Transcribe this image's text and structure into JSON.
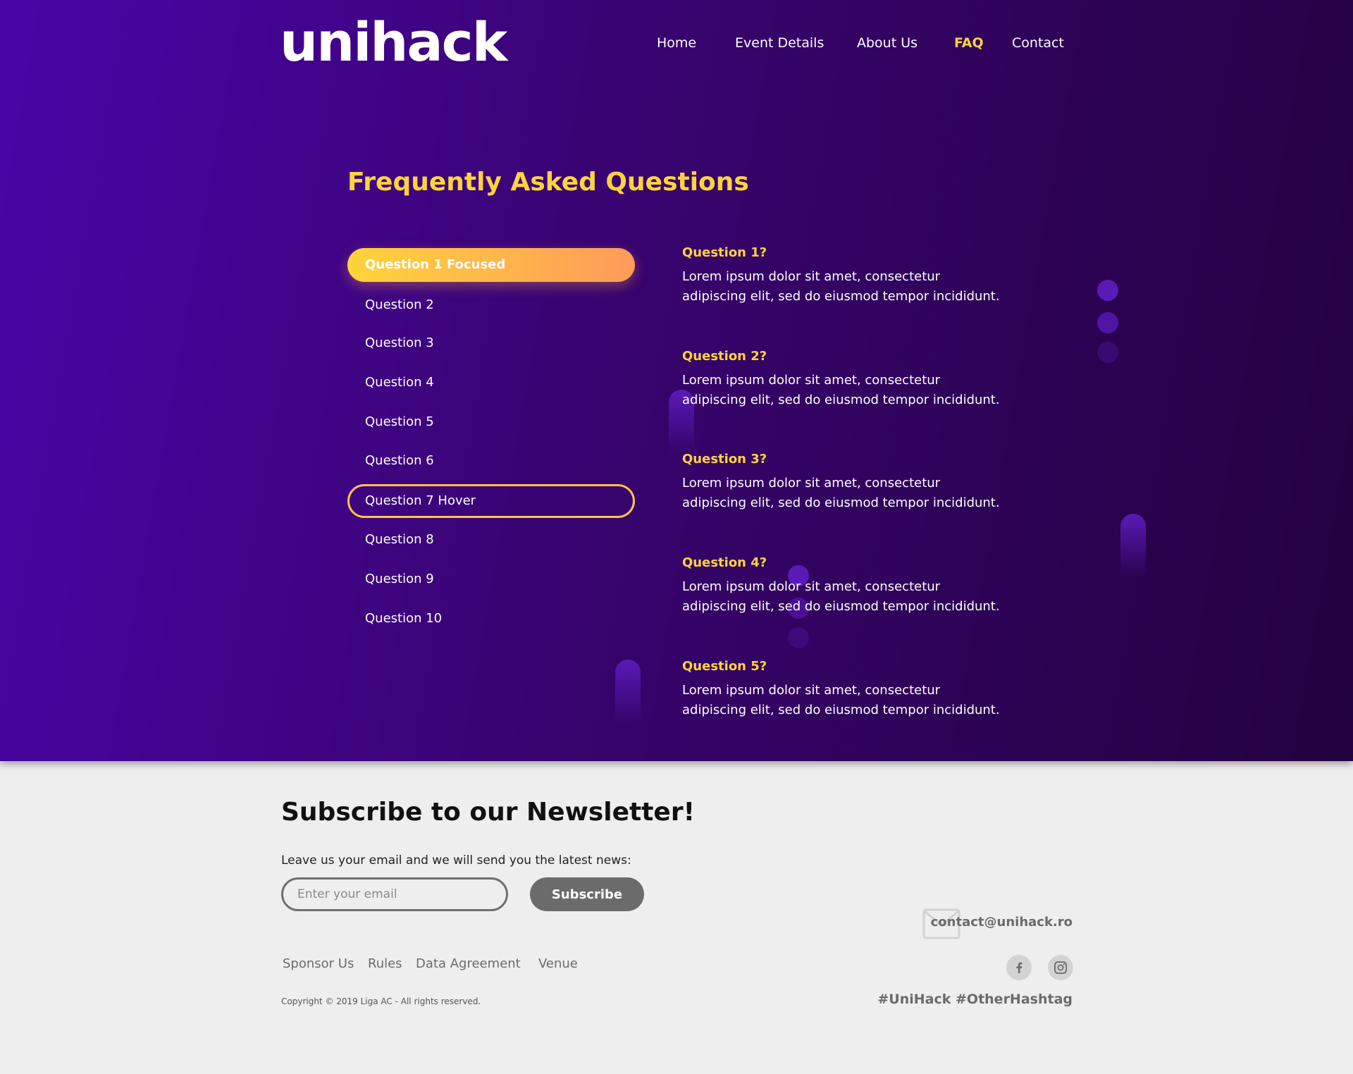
{
  "header": {
    "logo": "unihack",
    "nav": [
      {
        "label": "Home",
        "active": false
      },
      {
        "label": "Event Details",
        "active": false
      },
      {
        "label": "About Us",
        "active": false
      },
      {
        "label": "FAQ",
        "active": true
      },
      {
        "label": "Contact",
        "active": false
      }
    ]
  },
  "faq": {
    "title": "Frequently Asked Questions",
    "questions": [
      {
        "label": "Question 1 Focused",
        "state": "focused"
      },
      {
        "label": "Question 2",
        "state": "default"
      },
      {
        "label": "Question 3",
        "state": "default"
      },
      {
        "label": "Question 4",
        "state": "default"
      },
      {
        "label": "Question 5",
        "state": "default"
      },
      {
        "label": "Question 6",
        "state": "default"
      },
      {
        "label": "Question 7 Hover",
        "state": "hover"
      },
      {
        "label": "Question 8",
        "state": "default"
      },
      {
        "label": "Question 9",
        "state": "default"
      },
      {
        "label": "Question 10",
        "state": "default"
      }
    ],
    "answers": [
      {
        "question": "Question 1?",
        "text": "Lorem ipsum dolor sit amet, consectetur adipiscing elit, sed do eiusmod tempor incididunt."
      },
      {
        "question": "Question 2?",
        "text": "Lorem ipsum dolor sit amet, consectetur adipiscing elit, sed do eiusmod tempor incididunt."
      },
      {
        "question": "Question 3?",
        "text": "Lorem ipsum dolor sit amet, consectetur adipiscing elit, sed do eiusmod tempor incididunt."
      },
      {
        "question": "Question 4?",
        "text": "Lorem ipsum dolor sit amet, consectetur adipiscing elit, sed do eiusmod tempor incididunt."
      },
      {
        "question": "Question 5?",
        "text": "Lorem ipsum dolor sit amet, consectetur adipiscing elit, sed do eiusmod tempor incididunt."
      }
    ]
  },
  "newsletter": {
    "title": "Subscribe to our Newsletter!",
    "subtitle": "Leave us your email and we will send you the latest news:",
    "email_placeholder": "Enter your email",
    "email_value": "",
    "button_label": "Subscribe"
  },
  "footer": {
    "links": [
      "Sponsor Us",
      "Rules",
      "Data Agreement",
      "Venue"
    ],
    "copyright": "Copyright © 2019 Liga AC - All rights reserved.",
    "contact_email": "contact@unihack.ro",
    "socials": [
      {
        "icon": "facebook-icon"
      },
      {
        "icon": "instagram-icon"
      }
    ],
    "hashtags": "#UniHack #OtherHashtag"
  },
  "colors": {
    "accent": "#ffd43b",
    "hero_start": "#4a05a8",
    "hero_end": "#23023f",
    "footer_bg": "#eeeeee",
    "footer_gray": "#6b6b6b"
  }
}
